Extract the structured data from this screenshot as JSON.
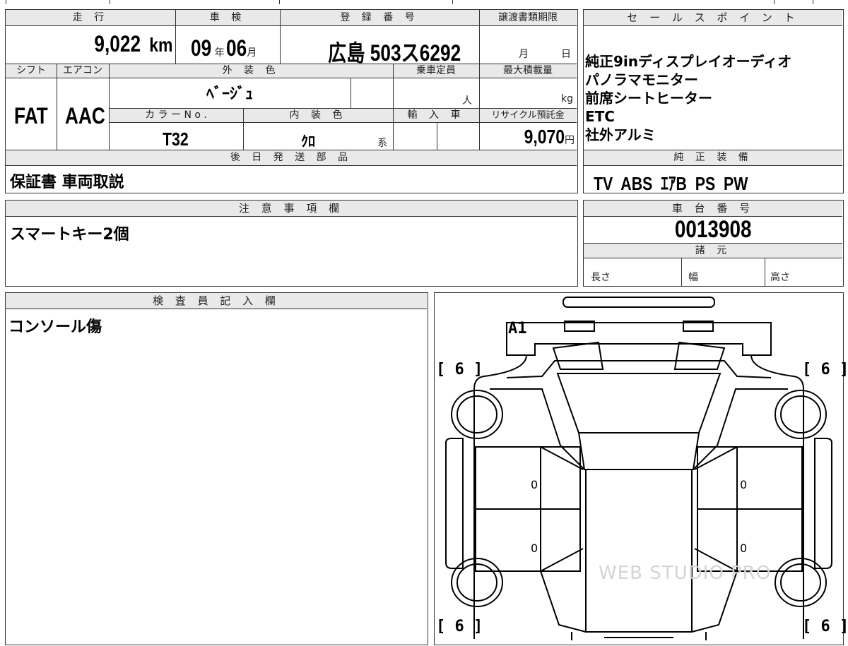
{
  "vehicle": {
    "mileage_label": "走 行",
    "mileage": "9,022",
    "mileage_unit": "km",
    "inspection_label": "車 検",
    "inspection_year": "09",
    "inspection_year_unit": "年",
    "inspection_month": "06",
    "inspection_month_unit": "月",
    "registration_label": "登 録 番 号",
    "registration_number": "広島 503ス6292",
    "transfer_deadline_label": "譲渡書類期限",
    "month_unit": "月",
    "day_unit": "日",
    "shift_label": "シフト",
    "shift": "FAT",
    "aircon_label": "エアコン",
    "aircon": "AAC",
    "exterior_color_label": "外 装 色",
    "exterior_color": "ﾍﾞｰｼﾞｭ",
    "capacity_label": "乗車定員",
    "capacity_unit": "人",
    "max_load_label": "最大積載量",
    "max_load_unit": "kg",
    "color_no_label": "カ ラ ー N o .",
    "color_no": "T32",
    "interior_color_label": "内 装 色",
    "interior_color": "ｸﾛ",
    "interior_suffix": "系",
    "import_label": "輸 入 車",
    "recycle_label": "リサイクル預託金",
    "recycle_fee": "9,070",
    "recycle_unit": "円",
    "later_parts_label": "後 日 発 送 部 品",
    "later_parts": "保証書 車両取説"
  },
  "sales_points": {
    "label": "セ ー ル ス ポ イ ン ト",
    "items": [
      "純正9inディスプレイオーディオ",
      "パノラマモニター",
      "前席シートヒーター",
      "ETC",
      "社外アルミ"
    ]
  },
  "standard_equipment": {
    "label": "純 正 装 備",
    "value": "TV  ABS  ｴｱB  PS  PW"
  },
  "notes": {
    "label": "注 意 事 項 欄",
    "text": "スマートキー2個"
  },
  "chassis": {
    "label": "車 台 番 号",
    "number": "0013908"
  },
  "specs": {
    "label": "諸 元",
    "length_label": "長さ",
    "width_label": "幅",
    "height_label": "高さ"
  },
  "inspector": {
    "label": "検 査 員 記 入 欄",
    "text": "コンソール傷"
  },
  "diagram": {
    "damage_mark": "A1",
    "tire_fl": "[ 6 ]",
    "tire_fr": "[ 6 ]",
    "tire_rl": "[ 6 ]",
    "tire_rr": "[ 6 ]",
    "door_marks": [
      "0",
      "0",
      "0",
      "0"
    ],
    "watermark": "WEB STUDIO PRO"
  }
}
